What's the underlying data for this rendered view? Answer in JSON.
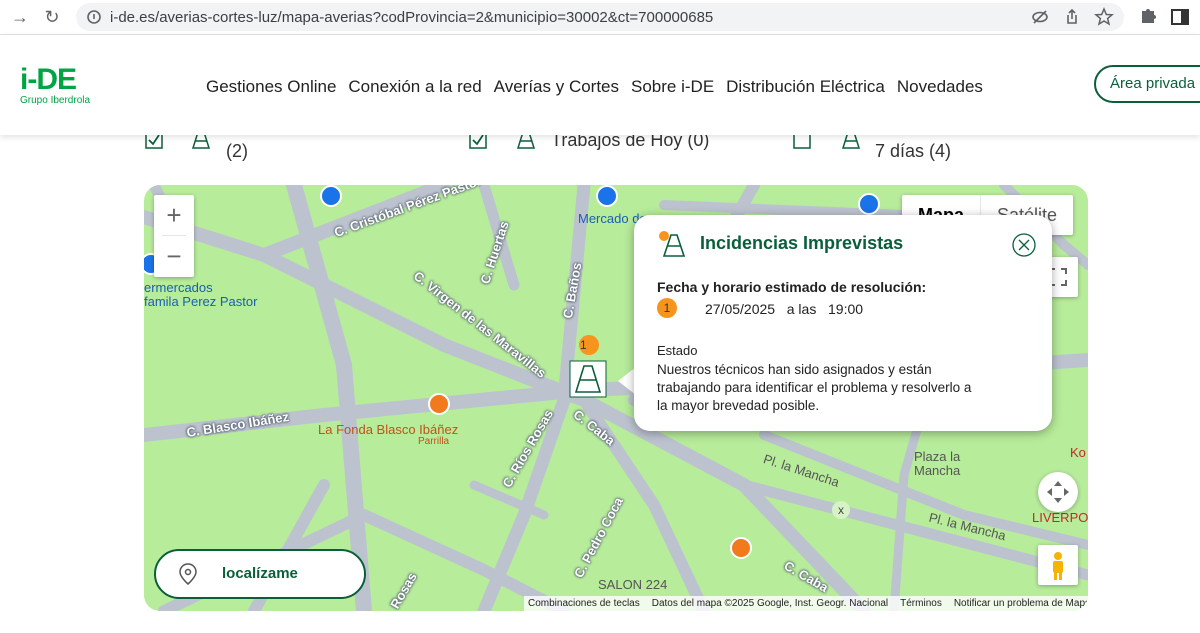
{
  "browser": {
    "url": "i-de.es/averias-cortes-luz/mapa-averias?codProvincia=2&municipio=30002&ct=700000685"
  },
  "header": {
    "logo_main": "i-DE",
    "logo_sub": "Grupo Iberdrola",
    "nav": [
      "Gestiones Online",
      "Conexión a la red",
      "Averías y Cortes",
      "Sobre i-DE",
      "Distribución Eléctrica",
      "Novedades"
    ],
    "area_privada": "Área privada"
  },
  "filters": {
    "item1_count": "(2)",
    "item2_label": "Trabajos de Hoy (0)",
    "item3_label": "7 días (4)"
  },
  "map": {
    "map_type_options": [
      "Mapa",
      "Satélite"
    ],
    "streets": {
      "cristobal": "C. Cristóbal Pérez Pastor",
      "huertas": "C. Huertas",
      "banos": "C. Baños",
      "virgen": "C. Virgen de las Maravillas",
      "blasco": "C. Blasco Ibáñez",
      "rios_rosas": "C. Ríos Rosas",
      "caba": "C. Caba",
      "caba2": "C. Caba",
      "pedro_coca": "C. Pedro Coca",
      "mancha": "Pl. la Mancha",
      "mancha2": "Pl. la Mancha",
      "rosas": "Rosas"
    },
    "pois": {
      "supermercado": "ermercados\nfamila Perez Pastor",
      "mercado": "Mercado de",
      "fonda": "La Fonda Blasco Ibáñez",
      "fonda_sub": "Parrilla",
      "plaza": "Plaza la\nMancha",
      "salon": "SALON 224",
      "liverpool": "LIVERPO",
      "ko": "Ko"
    },
    "marker_count": "1",
    "locate_label": "localízame",
    "attribution": [
      "Combinaciones de teclas",
      "Datos del mapa ©2025 Google, Inst. Geogr. Nacional",
      "Términos",
      "Notificar un problema de Maps"
    ]
  },
  "infowindow": {
    "title": "Incidencias Imprevistas",
    "label_fecha": "Fecha y horario estimado de resolución:",
    "badge": "1",
    "date": "27/05/2025",
    "a_las": "a las",
    "time": "19:00",
    "estado_label": "Estado",
    "estado_text": "Nuestros técnicos han sido asignados y están trabajando para identificar el problema y resolverlo a la mayor brevedad posible."
  },
  "colors": {
    "brand_green": "#00a443",
    "dark_green": "#0a5f3a",
    "map_green": "#b7ec9b",
    "road": "#bcc3cf",
    "accent_orange": "#f7941d"
  }
}
